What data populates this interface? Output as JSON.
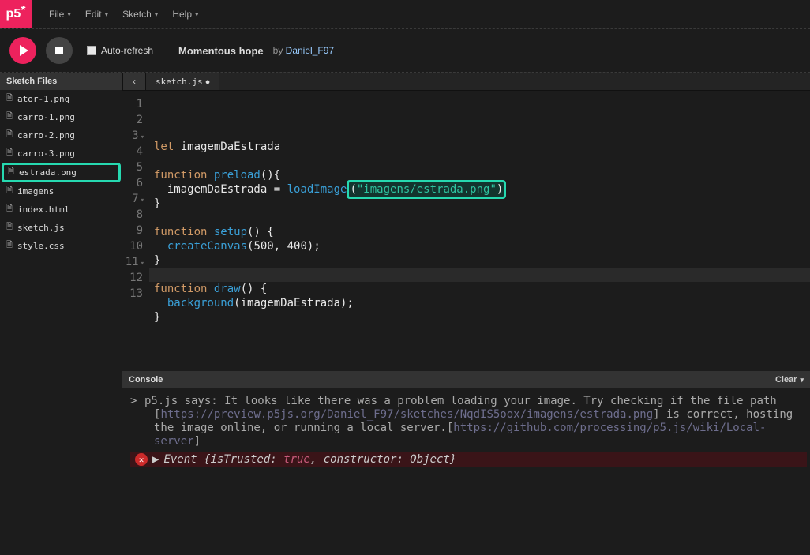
{
  "menus": [
    "File",
    "Edit",
    "Sketch",
    "Help"
  ],
  "toolbar": {
    "autorefresh_label": "Auto-refresh",
    "project_name": "Momentous hope",
    "by_label": "by",
    "author": "Daniel_F97"
  },
  "sidebar": {
    "title": "Sketch Files",
    "files": [
      "ator-1.png",
      "carro-1.png",
      "carro-2.png",
      "carro-3.png",
      "estrada.png",
      "imagens",
      "index.html",
      "sketch.js",
      "style.css"
    ],
    "highlight_index": 4
  },
  "tab": {
    "label": "sketch.js",
    "dirty": "●"
  },
  "code": {
    "lines": [
      {
        "n": "1",
        "fold": "",
        "seg": [
          [
            "kw",
            "let "
          ],
          [
            "ident",
            "imagemDaEstrada"
          ]
        ]
      },
      {
        "n": "2",
        "fold": "",
        "seg": []
      },
      {
        "n": "3",
        "fold": "▾",
        "seg": [
          [
            "fn",
            "function "
          ],
          [
            "builtin",
            "preload"
          ],
          [
            "paren",
            "(){"
          ]
        ]
      },
      {
        "n": "4",
        "fold": "",
        "seg": [
          [
            "ident",
            "  imagemDaEstrada = "
          ],
          [
            "builtin",
            "loadImage"
          ],
          [
            "hl_open",
            "("
          ],
          [
            "str",
            "\"imagens/estrada.png\""
          ],
          [
            "hl_close",
            ")"
          ]
        ]
      },
      {
        "n": "5",
        "fold": "",
        "seg": [
          [
            "paren",
            "}"
          ]
        ]
      },
      {
        "n": "6",
        "fold": "",
        "seg": []
      },
      {
        "n": "7",
        "fold": "▾",
        "seg": [
          [
            "fn",
            "function "
          ],
          [
            "builtin",
            "setup"
          ],
          [
            "paren",
            "() {"
          ]
        ]
      },
      {
        "n": "8",
        "fold": "",
        "seg": [
          [
            "ident",
            "  "
          ],
          [
            "builtin",
            "createCanvas"
          ],
          [
            "paren",
            "("
          ],
          [
            "num",
            "500, 400"
          ],
          [
            "paren",
            ");"
          ]
        ]
      },
      {
        "n": "9",
        "fold": "",
        "seg": [
          [
            "paren",
            "}"
          ]
        ]
      },
      {
        "n": "10",
        "fold": "",
        "seg": []
      },
      {
        "n": "11",
        "fold": "▾",
        "seg": [
          [
            "fn",
            "function "
          ],
          [
            "builtin",
            "draw"
          ],
          [
            "paren",
            "() {"
          ]
        ]
      },
      {
        "n": "12",
        "fold": "",
        "seg": [
          [
            "ident",
            "  "
          ],
          [
            "builtin",
            "background"
          ],
          [
            "paren",
            "("
          ],
          [
            "ident",
            "imagemDaEstrada"
          ],
          [
            "paren",
            ");"
          ]
        ]
      },
      {
        "n": "13",
        "fold": "",
        "seg": [
          [
            "paren",
            "}"
          ]
        ]
      }
    ]
  },
  "console": {
    "title": "Console",
    "clear_label": "Clear",
    "msg_pre": "p5.js says: It looks like there was a problem loading your image. Try checking if the file path [",
    "msg_link1": "https://preview.p5js.org/Daniel_F97/sketches/NqdIS5oox/imagens/estrada.png",
    "msg_mid": "] is correct, hosting the image online, or running a local server.[",
    "msg_link2": "https://github.com/processing/p5.js/wiki/Local-server",
    "msg_post": "]",
    "err_symbol": "✕",
    "err_caret": "▶",
    "err_pre": "Event {isTrusted: ",
    "err_true": "true",
    "err_post": ", constructor: Object}"
  }
}
